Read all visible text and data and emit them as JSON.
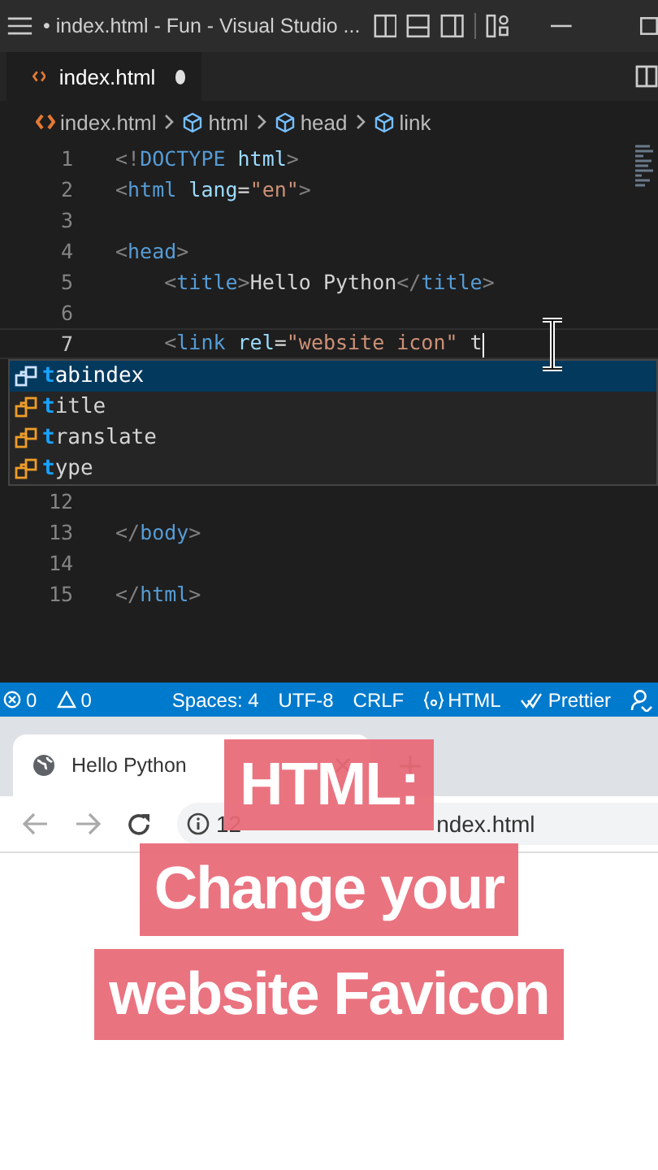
{
  "window": {
    "title": "• index.html - Fun - Visual Studio ..."
  },
  "editor_tab": {
    "label": "index.html",
    "modified": true
  },
  "breadcrumbs": [
    "index.html",
    "html",
    "head",
    "link"
  ],
  "code_lines": [
    {
      "number": "1",
      "active": false,
      "tokens": [
        {
          "kind": "punct",
          "text": "<!"
        },
        {
          "kind": "tag",
          "text": "DOCTYPE"
        },
        {
          "kind": "attr",
          "text": " html"
        },
        {
          "kind": "punct",
          "text": ">"
        }
      ]
    },
    {
      "number": "2",
      "active": false,
      "tokens": [
        {
          "kind": "punct",
          "text": "<"
        },
        {
          "kind": "tag",
          "text": "html"
        },
        {
          "kind": "attr",
          "text": " lang"
        },
        {
          "kind": "text",
          "text": "="
        },
        {
          "kind": "string",
          "text": "\"en\""
        },
        {
          "kind": "punct",
          "text": ">"
        }
      ]
    },
    {
      "number": "3",
      "active": false
    },
    {
      "number": "4",
      "active": false,
      "tokens": [
        {
          "kind": "punct",
          "text": "<"
        },
        {
          "kind": "tag",
          "text": "head"
        },
        {
          "kind": "punct",
          "text": ">"
        }
      ]
    },
    {
      "number": "5",
      "active": false,
      "tokens": [
        {
          "kind": "punct",
          "text": "    <"
        },
        {
          "kind": "tag",
          "text": "title"
        },
        {
          "kind": "punct",
          "text": ">"
        },
        {
          "kind": "text",
          "text": "Hello Python"
        },
        {
          "kind": "punct",
          "text": "</"
        },
        {
          "kind": "tag",
          "text": "title"
        },
        {
          "kind": "punct",
          "text": ">"
        }
      ]
    },
    {
      "number": "6",
      "active": false
    },
    {
      "number": "7",
      "active": true,
      "tokens": [
        {
          "kind": "punct",
          "text": "    <"
        },
        {
          "kind": "tag",
          "text": "link"
        },
        {
          "kind": "attr",
          "text": " rel"
        },
        {
          "kind": "text",
          "text": "="
        },
        {
          "kind": "string",
          "text": "\"website icon\""
        },
        {
          "kind": "text",
          "text": " t"
        }
      ]
    }
  ],
  "suggestions": [
    {
      "match": "t",
      "rest": "abindex",
      "selected": true
    },
    {
      "match": "t",
      "rest": "itle",
      "selected": false
    },
    {
      "match": "t",
      "rest": "ranslate",
      "selected": false
    },
    {
      "match": "t",
      "rest": "ype",
      "selected": false
    }
  ],
  "code_lines_after": [
    {
      "number": "12"
    },
    {
      "number": "13",
      "tokens": [
        {
          "kind": "punct",
          "text": "</"
        },
        {
          "kind": "tag",
          "text": "body"
        },
        {
          "kind": "punct",
          "text": ">"
        }
      ]
    },
    {
      "number": "14"
    },
    {
      "number": "15",
      "tokens": [
        {
          "kind": "punct",
          "text": "</"
        },
        {
          "kind": "tag",
          "text": "html"
        },
        {
          "kind": "punct",
          "text": ">"
        }
      ]
    }
  ],
  "status_bar": {
    "errors": "0",
    "warnings": "0",
    "items": [
      "Spaces: 4",
      "UTF-8",
      "CRLF"
    ],
    "language": "HTML",
    "formatter": "Prettier"
  },
  "browser": {
    "tab_title": "Hello Python",
    "address_start": "12",
    "address_end": "ndex.html"
  },
  "caption": [
    "HTML:",
    "Change your",
    "website Favicon"
  ]
}
